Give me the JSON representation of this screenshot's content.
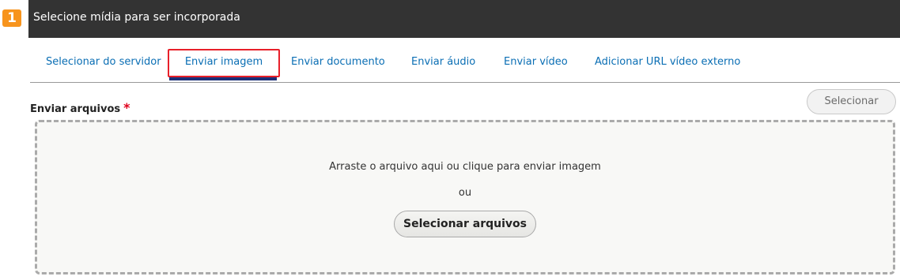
{
  "step_badge": "1",
  "header": {
    "title": "Selecione mídia para ser incorporada"
  },
  "tabs": [
    {
      "label": "Selecionar do servidor",
      "active": false
    },
    {
      "label": "Enviar imagem",
      "active": true
    },
    {
      "label": "Enviar documento",
      "active": false
    },
    {
      "label": "Enviar áudio",
      "active": false
    },
    {
      "label": "Enviar vídeo",
      "active": false
    },
    {
      "label": "Adicionar URL vídeo externo",
      "active": false
    }
  ],
  "upload": {
    "label": "Enviar arquivos",
    "required_marker": "*",
    "select_button": "Selecionar",
    "dropzone_text": "Arraste o arquivo aqui ou clique para enviar imagem",
    "or_text": "ou",
    "files_button": "Selecionar arquivos"
  },
  "colors": {
    "header_bg": "#333333",
    "badge": "#f7941d",
    "tab_link": "#0a6eb4",
    "active_underline": "#1c2f78",
    "active_highlight": "#e8202a",
    "required": "#e0001b"
  }
}
